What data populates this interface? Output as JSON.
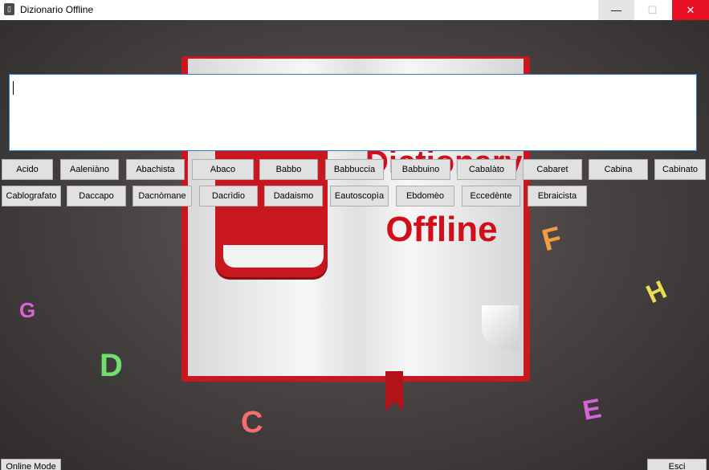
{
  "window": {
    "title": "Dizionario Offline",
    "controls": {
      "minimize": "—",
      "maximize": "☐",
      "close": "✕"
    }
  },
  "background": {
    "book_line1": "Dictionary",
    "book_line2": "Offline",
    "letters": [
      "G",
      "D",
      "C",
      "F",
      "H",
      "E"
    ],
    "accent_color": "#c8171f"
  },
  "search": {
    "value": ""
  },
  "word_buttons": {
    "row1": [
      "Acido",
      "Aaleniàno",
      "Abachista",
      "Abaco",
      "Babbo",
      "Babbuccia",
      "Babbuino",
      "Cabalàto",
      "Cabaret",
      "Cabina",
      "Cabinato"
    ],
    "row2": [
      "Cablografato",
      "Daccapo",
      "Dacnòmane",
      "Dacrìdio",
      "Dadaismo",
      "Eautoscopìa",
      "Ebdomèo",
      "Eccedènte",
      "Ebraicista"
    ]
  },
  "footer": {
    "online_mode": "Online Mode",
    "exit": "Esci"
  }
}
